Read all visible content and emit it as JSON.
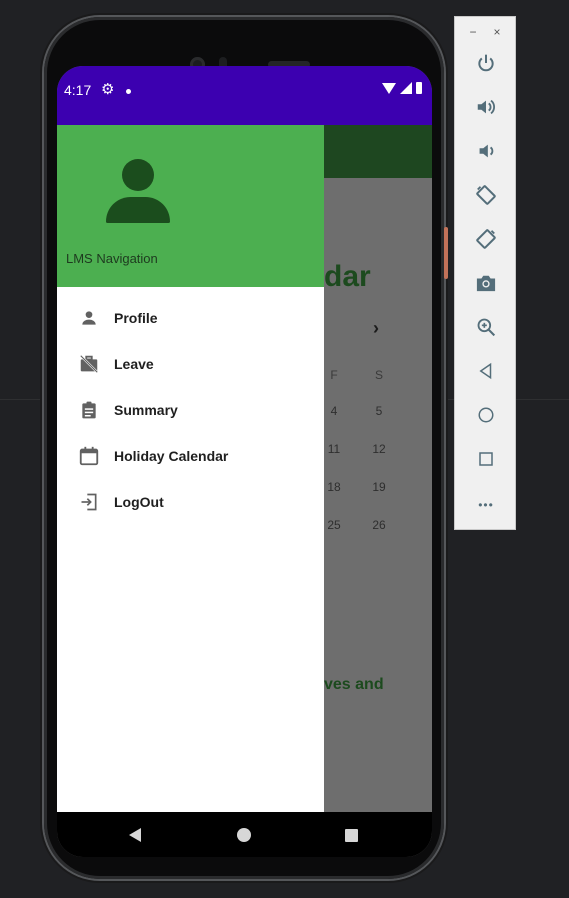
{
  "status_bar": {
    "time": "4:17"
  },
  "drawer": {
    "header_title": "LMS Navigation",
    "items": [
      {
        "label": "Profile",
        "icon": "person-icon"
      },
      {
        "label": "Leave",
        "icon": "work-off-icon"
      },
      {
        "label": "Summary",
        "icon": "assignment-icon"
      },
      {
        "label": "Holiday Calendar",
        "icon": "calendar-icon"
      },
      {
        "label": "LogOut",
        "icon": "logout-icon"
      }
    ]
  },
  "background_app": {
    "title_fragment": "dar",
    "weekday_f": "F",
    "weekday_s": "S",
    "rows": [
      [
        "4",
        "5"
      ],
      [
        "11",
        "12"
      ],
      [
        "18",
        "19"
      ],
      [
        "25",
        "26"
      ]
    ],
    "bottom_fragment": "ves and"
  },
  "emulator": {
    "minimize": "−",
    "close": "×",
    "more": "•••"
  },
  "colors": {
    "status_bar": "#3c00b0",
    "drawer_header": "#4caf50",
    "app_bar": "#1e4720"
  }
}
